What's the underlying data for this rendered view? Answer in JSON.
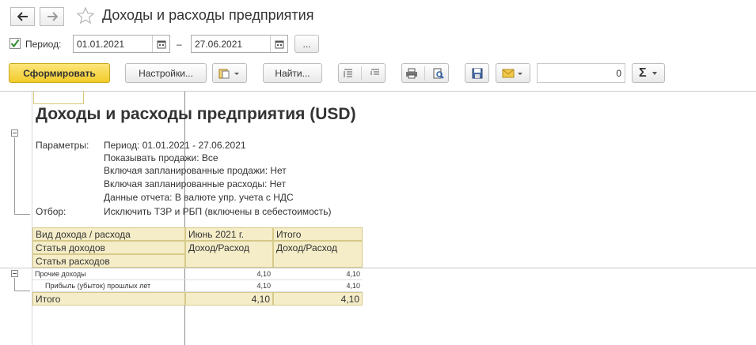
{
  "window": {
    "title": "Доходы и расходы предприятия"
  },
  "period": {
    "label": "Период:",
    "from": "01.01.2021",
    "to": "27.06.2021",
    "dash": "–",
    "more": "..."
  },
  "toolbar": {
    "generate_label": "Сформировать",
    "settings_label": "Настройки...",
    "find_label": "Найти...",
    "sum_value": "0",
    "sigma": "Σ"
  },
  "report": {
    "title": "Доходы и расходы предприятия (USD)",
    "params_label": "Параметры:",
    "params": [
      "Период: 01.01.2021 - 27.06.2021",
      "Показывать продажи: Все",
      "Включая запланированные продажи: Нет",
      "Включая запланированные расходы: Нет",
      "Данные отчета: В валюте упр. учета с НДС"
    ],
    "filter_label": "Отбор:",
    "filter_value": "Исключить ТЗР и РБП (включены в себестоимость)"
  },
  "table": {
    "header": {
      "col1": [
        "Вид дохода / расхода",
        "Статья доходов",
        "Статья расходов"
      ],
      "col2_top": "Июнь 2021 г.",
      "col2_sub": "Доход/Расход",
      "col3_top": "Итого",
      "col3_sub": "Доход/Расход"
    },
    "rows": [
      {
        "name": "Прочие доходы",
        "june": "4,10",
        "total": "4,10"
      },
      {
        "name": "Прибыль (убыток) прошлых лет",
        "june": "4,10",
        "total": "4,10"
      }
    ],
    "total": {
      "name": "Итого",
      "june": "4,10",
      "total": "4,10"
    }
  },
  "colors": {
    "accent": "#f7d23e",
    "header_bg": "#f5edc8"
  }
}
